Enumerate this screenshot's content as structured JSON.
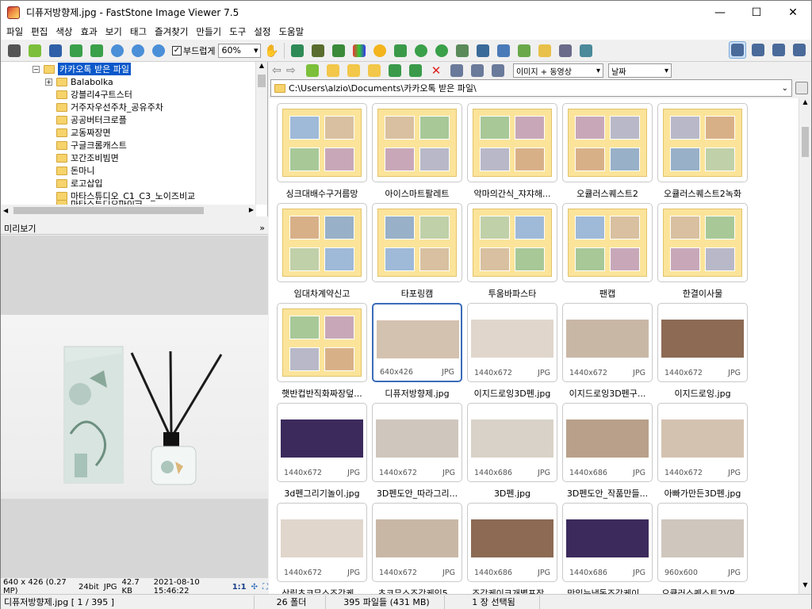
{
  "window": {
    "title": "디퓨저방향제.jpg  -  FastStone Image Viewer 7.5",
    "controls": {
      "minimize": "—",
      "maximize": "☐",
      "close": "✕"
    }
  },
  "menu": [
    "파일",
    "편집",
    "색상",
    "효과",
    "보기",
    "태그",
    "즐겨찾기",
    "만들기",
    "도구",
    "설정",
    "도움말"
  ],
  "toolbar": {
    "smooth_label": "부드럽게",
    "smooth_checked": "✓",
    "zoom_value": "60%"
  },
  "tree": {
    "selected": "카카오톡 받은 파일",
    "items": [
      "Balabolka",
      "강블리4구트스터",
      "거주자우선주차_공유주차",
      "공공버터크로플",
      "교동짜장면",
      "구글크롬캐스트",
      "꼬간조비빔면",
      "돈마니",
      "로고삽입",
      "마타스튜디오_C1_C3_노이즈비교",
      "마타스튜디오마이크"
    ]
  },
  "preview": {
    "label": "미리보기",
    "info": {
      "dims": "640 x 426 (0.27 MP)",
      "bits": "24bit",
      "type": "JPG",
      "size": "42.7 KB",
      "date": "2021-08-10 15:46:22",
      "ratio": "1:1"
    }
  },
  "filter": {
    "type": "이미지 + 동영상",
    "sort": "날짜"
  },
  "path": "C:\\Users\\alzio\\Documents\\카카오톡 받은 파일\\",
  "thumbnails": [
    {
      "name": "싱크대배수구거름망",
      "kind": "folder"
    },
    {
      "name": "아이스마트팔레트",
      "kind": "folder"
    },
    {
      "name": "악마의간식_쟈쟈해...",
      "kind": "folder"
    },
    {
      "name": "오큘러스퀘스트2",
      "kind": "folder"
    },
    {
      "name": "오큘러스퀘스트2녹화",
      "kind": "folder"
    },
    {
      "name": "임대차계약신고",
      "kind": "folder"
    },
    {
      "name": "타포링캠",
      "kind": "folder"
    },
    {
      "name": "투움바파스타",
      "kind": "folder"
    },
    {
      "name": "팬캡",
      "kind": "folder"
    },
    {
      "name": "한결이사물",
      "kind": "folder"
    },
    {
      "name": "햇반컵반직화짜장덮...",
      "kind": "folder"
    },
    {
      "name": "디퓨저방향제.jpg",
      "kind": "image",
      "dims": "640x426",
      "ext": "JPG",
      "selected": true
    },
    {
      "name": "이지드로잉3D펜.jpg",
      "kind": "image",
      "dims": "1440x672",
      "ext": "JPG"
    },
    {
      "name": "이지드로잉3D펜구...",
      "kind": "image",
      "dims": "1440x672",
      "ext": "JPG"
    },
    {
      "name": "이지드로잉.jpg",
      "kind": "image",
      "dims": "1440x672",
      "ext": "JPG"
    },
    {
      "name": "3d펜그리기놀이.jpg",
      "kind": "image",
      "dims": "1440x672",
      "ext": "JPG"
    },
    {
      "name": "3D펜도안_따라그리...",
      "kind": "image",
      "dims": "1440x672",
      "ext": "JPG"
    },
    {
      "name": "3D펜.jpg",
      "kind": "image",
      "dims": "1440x686",
      "ext": "JPG"
    },
    {
      "name": "3D펜도안_작품만들...",
      "kind": "image",
      "dims": "1440x686",
      "ext": "JPG"
    },
    {
      "name": "아빠가만든3D펜.jpg",
      "kind": "image",
      "dims": "1440x672",
      "ext": "JPG"
    },
    {
      "name": "삼립초코무스조각케...",
      "kind": "image",
      "dims": "1440x672",
      "ext": "JPG"
    },
    {
      "name": "초코무스조각케익5...",
      "kind": "image",
      "dims": "1440x672",
      "ext": "JPG"
    },
    {
      "name": "조각케이크개별포장...",
      "kind": "image",
      "dims": "1440x686",
      "ext": "JPG"
    },
    {
      "name": "맛있는냉동조각케이...",
      "kind": "image",
      "dims": "1440x686",
      "ext": "JPG"
    },
    {
      "name": "오큘러스퀘스트2VR...",
      "kind": "image",
      "dims": "960x600",
      "ext": "JPG"
    }
  ],
  "status": {
    "file": "디퓨저방향제.jpg [ 1 / 395 ]",
    "folders": "26 폴더",
    "files": "395 파일들 (431 MB)",
    "selected": "1 장 선택됨"
  },
  "colors": {
    "selection": "#0a58ca",
    "folder_thumb": "#fbe49a",
    "selected_border": "#3a6cb8"
  }
}
